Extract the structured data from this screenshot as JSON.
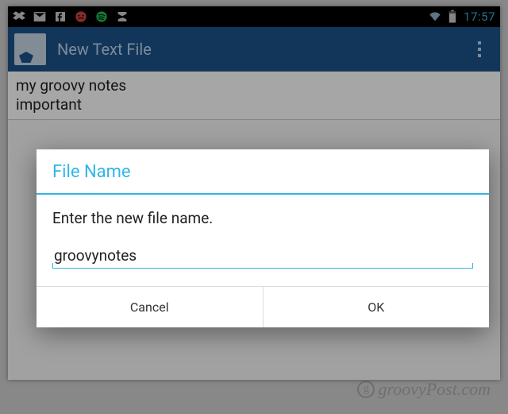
{
  "statusbar": {
    "clock": "17:57"
  },
  "actionbar": {
    "title": "New Text File"
  },
  "editor": {
    "line1": "my groovy notes",
    "line2": "important"
  },
  "dialog": {
    "title": "File Name",
    "message": "Enter the new file name.",
    "input_value": "groovynotes",
    "cancel_label": "Cancel",
    "ok_label": "OK"
  },
  "watermark": {
    "text": "groovyPost.com"
  }
}
